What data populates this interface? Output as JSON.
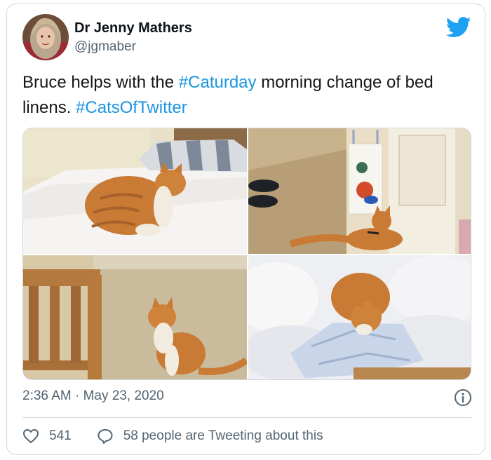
{
  "author": {
    "name": "Dr Jenny Mathers",
    "handle": "@jgmaber"
  },
  "tweet": {
    "text_before": "Bruce helps with the ",
    "hashtag_1": "#Caturday",
    "text_middle": " morning change of bed linens. ",
    "hashtag_2": "#CatsOfTwitter"
  },
  "timestamp": "2:36 AM · May 23, 2020",
  "stats": {
    "likes": "541",
    "conversation": "58 people are Tweeting about this"
  },
  "colors": {
    "hashtag": "#1b95e0",
    "twitter_blue": "#1da1f2",
    "muted": "#536471"
  },
  "icons": [
    "twitter-bird-icon",
    "info-icon",
    "heart-icon",
    "speech-bubble-icon"
  ]
}
